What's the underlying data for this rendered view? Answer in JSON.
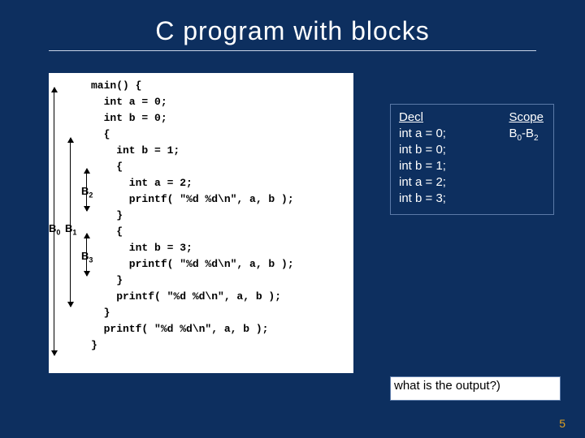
{
  "title": "C program with blocks",
  "code_raw": "main() {\n  int a = 0;\n  int b = 0;\n  {\n    int b = 1;\n    {\n      int a = 2;\n      printf( \"%d %d\\n\", a, b );\n    }\n    {\n      int b = 3;\n      printf( \"%d %d\\n\", a, b );\n    }\n    printf( \"%d %d\\n\", a, b );\n  }\n  printf( \"%d %d\\n\", a, b );\n}",
  "block_labels": {
    "b0": "B",
    "b0_sub": "0",
    "b1": "B",
    "b1_sub": "1",
    "b2": "B",
    "b2_sub": "2",
    "b3": "B",
    "b3_sub": "3"
  },
  "decl": {
    "header": "Decl",
    "rows": [
      "int a = 0;",
      "int b = 0;",
      "int b = 1;",
      "int a = 2;",
      "int b = 3;"
    ]
  },
  "scope": {
    "header": "Scope",
    "b0b2_prefix": "B",
    "b0b2_sub1": "0",
    "b0b2_dash": "-B",
    "b0b2_sub2": "2"
  },
  "output_question": "what is the output?)",
  "page_number": "5"
}
